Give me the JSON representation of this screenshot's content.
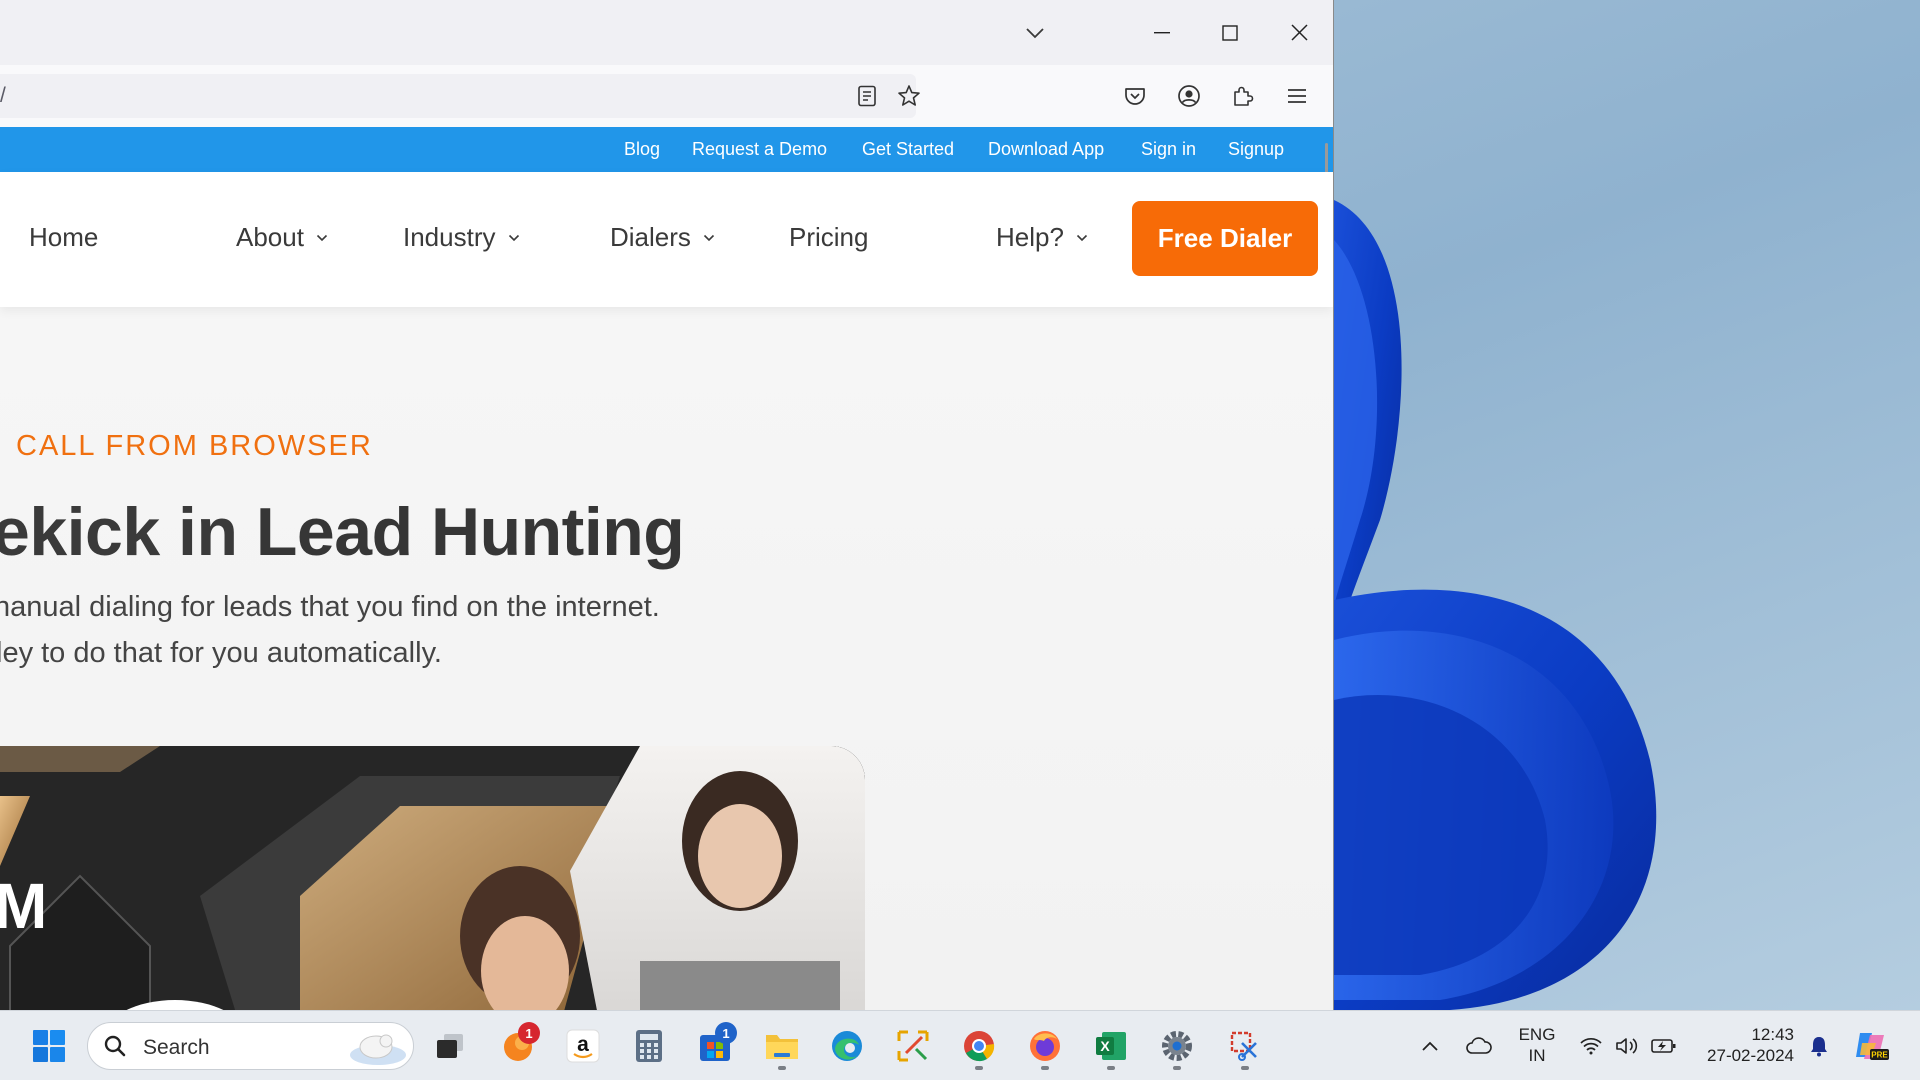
{
  "browser": {
    "url_fragment": "/",
    "tooltips": []
  },
  "site": {
    "top_links": [
      "Blog",
      "Request a Demo",
      "Get Started",
      "Download App",
      "Sign in",
      "Signup"
    ],
    "menu": {
      "home": "Home",
      "about": "About",
      "industry": "Industry",
      "dialers": "Dialers",
      "pricing": "Pricing",
      "help": "Help?"
    },
    "cta_label": "Free Dialer",
    "accent_blue": "#2196e9",
    "accent_orange": "#f76b07"
  },
  "hero": {
    "eyebrow": "CALL FROM BROWSER",
    "heading_plain": "ekick in ",
    "heading_bold": "Lead Hunting",
    "line1": "nanual dialing for leads that you find on the internet.",
    "line2": "ley to do that for you automatically.",
    "image_letter": "M"
  },
  "taskbar": {
    "search_placeholder": "Search",
    "badges": {
      "app1": "1",
      "store": "1"
    },
    "amazon_glyph": "a",
    "excel_glyph": "X",
    "lang_line1": "ENG",
    "lang_line2": "IN",
    "time": "12:43",
    "date": "27-02-2024",
    "copilot_badge": "PRE"
  }
}
